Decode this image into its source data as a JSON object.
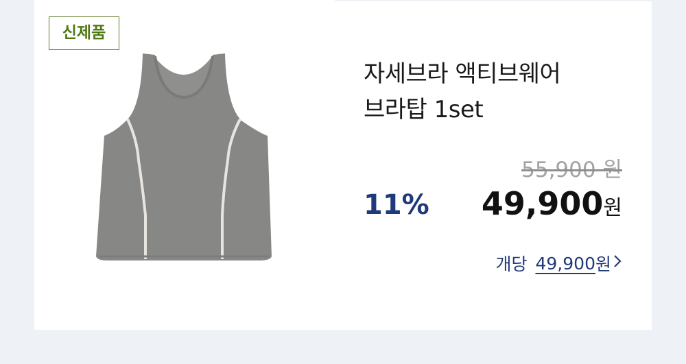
{
  "badge": {
    "label": "신제품"
  },
  "product": {
    "title_line1": "자세브라 액티브웨어",
    "title_line2": "브라탑 1set",
    "image": "gray-bra-tank-top"
  },
  "pricing": {
    "original_price": "55,900",
    "original_unit": "원",
    "discount": "11%",
    "sale_price": "49,900",
    "sale_unit": "원",
    "per_unit_label": "개당",
    "per_unit_price": "49,900",
    "per_unit_currency": "원"
  },
  "colors": {
    "badge": "#4d7a12",
    "accent": "#1f3a7a",
    "background": "#eef2f7"
  },
  "icons": {
    "per_unit_link": "chevron-right-icon"
  }
}
